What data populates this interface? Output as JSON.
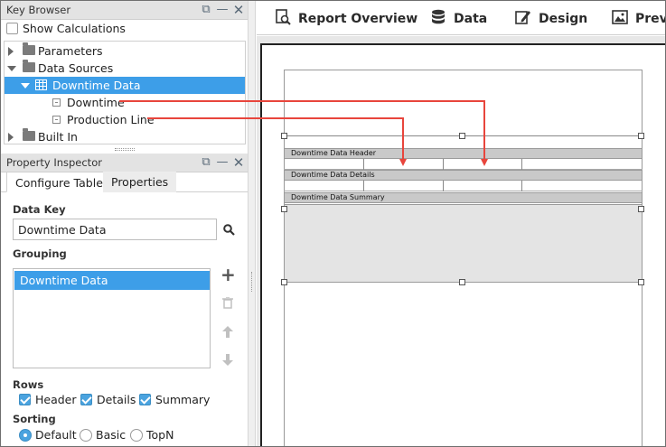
{
  "key_browser": {
    "title": "Key Browser",
    "show_calculations_label": "Show Calculations",
    "show_calculations_checked": false,
    "tree": {
      "parameters": "Parameters",
      "data_sources": "Data Sources",
      "downtime_data": "Downtime Data",
      "downtime": "Downtime",
      "production_line": "Production Line",
      "built_in": "Built In"
    }
  },
  "property_inspector": {
    "title": "Property Inspector",
    "tabs": [
      "Configure Table",
      "Properties"
    ],
    "data_key_label": "Data Key",
    "data_key_value": "Downtime Data",
    "grouping_label": "Grouping",
    "grouping_items": [
      "Downtime Data"
    ],
    "rows_label": "Rows",
    "rows_options": [
      "Header",
      "Details",
      "Summary"
    ],
    "sorting_label": "Sorting",
    "sorting_options": [
      "Default",
      "Basic",
      "TopN"
    ],
    "sorting_selected": "Default"
  },
  "toolbar": {
    "report_overview": "Report Overview",
    "data": "Data",
    "design": "Design",
    "preview": "Prev"
  },
  "canvas": {
    "header_band": "Downtime Data Header",
    "details_band": "Downtime Data Details",
    "summary_band": "Downtime Data Summary"
  },
  "colors": {
    "selection": "#3d9ee8",
    "arrow": "#e8453c",
    "band": "#c9c9c9"
  }
}
